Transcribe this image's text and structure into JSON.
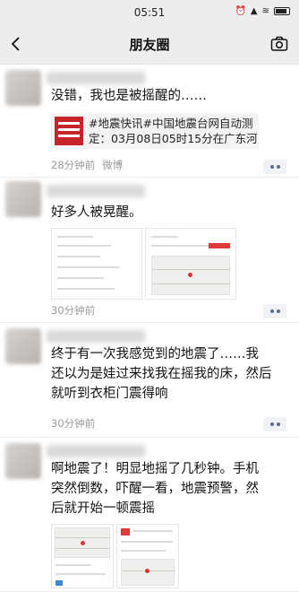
{
  "status_bar": {
    "time": "05:51",
    "indicators": "⏰ ★ ▲ 5G"
  },
  "nav": {
    "title": "朋友圈",
    "back_icon": "chevron-left-icon",
    "camera_icon": "camera-icon"
  },
  "posts": [
    {
      "text": "没错，我也是被摇醒的……",
      "share": {
        "line1": "#地震快讯#中国地震台网自动测",
        "line2": "定：03月08日05时15分在广东河…"
      },
      "time": "28分钟前",
      "source": "微博"
    },
    {
      "text": "好多人被晃醒。",
      "time": "30分钟前",
      "source": ""
    },
    {
      "text_lines": [
        "终于有一次我感觉到的地震了……我",
        "还以为是娃过来找我在摇我的床，然后",
        "就听到衣柜门震得响"
      ],
      "time": "30分钟前",
      "source": ""
    },
    {
      "text_lines": [
        "啊地震了！明显地摇了几秒钟。手机",
        "突然倒数，吓醒一看，地震预警，然",
        "后就开始一顿震摇"
      ],
      "time": "",
      "source": ""
    }
  ]
}
